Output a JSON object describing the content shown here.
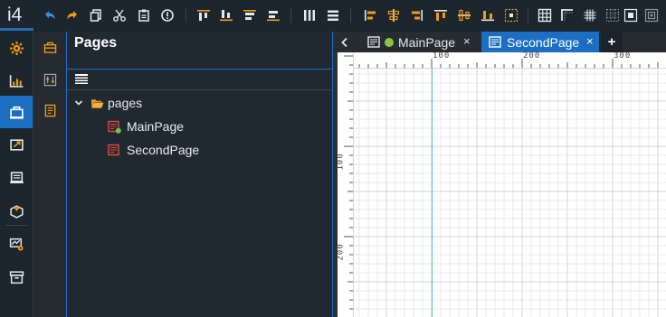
{
  "app": {
    "logo": "i4",
    "accent": "#1b6ec2",
    "icon_color": "#f39c12"
  },
  "toolbar": {
    "icons": [
      "undo-icon",
      "redo-icon",
      "copy-icon",
      "cut-icon",
      "paste-icon",
      "info-icon",
      "align-top-icon",
      "align-bottom-icon",
      "align-middle-icon",
      "distribute-vertical-icon",
      "columns-icon",
      "rows-icon",
      "align-left-icon",
      "align-center-icon",
      "align-right-icon",
      "align-top-edge-icon",
      "align-bottom-edge-icon",
      "bar-chart-icon",
      "center-icon",
      "grid-icon",
      "corner-icon",
      "grid-dense-icon",
      "grid-dots-icon",
      "grid-center-icon",
      "frame-icon"
    ]
  },
  "sidebar": {
    "items": [
      {
        "name": "settings-gear-icon",
        "active": false
      },
      {
        "name": "dashboard-chart-icon",
        "active": false
      },
      {
        "name": "pages-icon",
        "active": true
      },
      {
        "name": "export-page-icon",
        "active": false
      },
      {
        "name": "components-icon",
        "active": false
      },
      {
        "name": "package-icon",
        "active": false
      },
      {
        "name": "monitor-config-icon",
        "active": false
      },
      {
        "name": "archive-icon",
        "active": false
      }
    ]
  },
  "subbar": {
    "items": [
      "toolbox-icon",
      "properties-icon",
      "notes-icon"
    ]
  },
  "panel": {
    "title": "Pages",
    "tree": {
      "root": "pages",
      "children": [
        "MainPage",
        "SecondPage"
      ]
    }
  },
  "tabs": [
    {
      "label": "MainPage",
      "active": false,
      "status": "online"
    },
    {
      "label": "SecondPage",
      "active": true
    }
  ],
  "tab_close_glyph": "×",
  "tab_add_glyph": "+",
  "tab_back_glyph": "<",
  "ruler": {
    "top_labels": [
      "100",
      "200",
      "300"
    ],
    "left_labels": [
      "100",
      "200"
    ]
  }
}
